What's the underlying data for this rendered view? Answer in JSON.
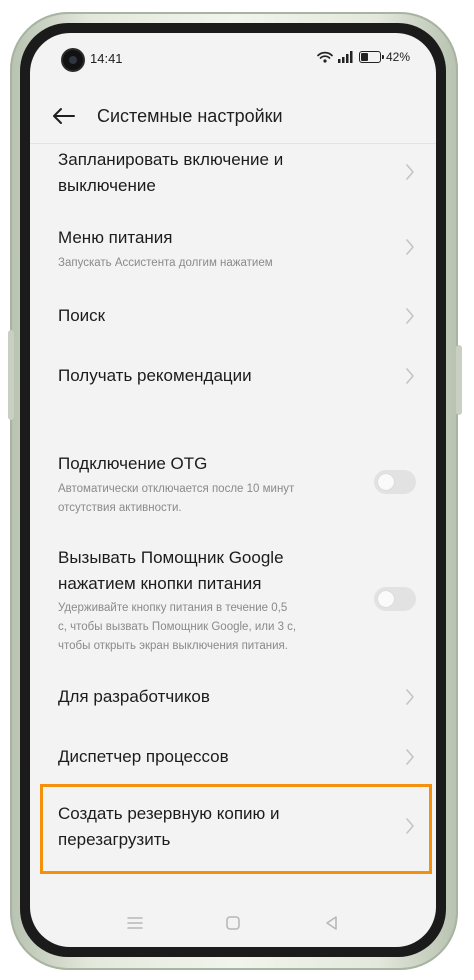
{
  "status_bar": {
    "time": "14:41",
    "battery_percent": "42%",
    "battery_level": 0.42
  },
  "header": {
    "title": "Системные настройки",
    "back_icon": "arrow-left-icon"
  },
  "items": [
    {
      "title_line1": "Запланировать включение и",
      "title_line2": "выключение",
      "control": "chevron"
    },
    {
      "title": "Меню питания",
      "subtitle": "Запускать Ассистента долгим нажатием",
      "control": "chevron"
    },
    {
      "title": "Поиск",
      "control": "chevron"
    },
    {
      "title": "Получать рекомендации",
      "control": "chevron"
    },
    {
      "title": "Подключение OTG",
      "subtitle_line1": "Автоматически отключается после 10 минут",
      "subtitle_line2": "отсутствия активности.",
      "control": "toggle",
      "on": false
    },
    {
      "title_line1": "Вызывать Помощник Google",
      "title_line2": "нажатием кнопки питания",
      "subtitle_line1": "Удерживайте кнопку питания в течение 0,5",
      "subtitle_line2": "с, чтобы вызвать Помощник Google, или 3 с,",
      "subtitle_line3": "чтобы открыть экран выключения питания.",
      "control": "toggle",
      "on": false
    },
    {
      "title": "Для разработчиков",
      "control": "chevron"
    },
    {
      "title": "Диспетчер процессов",
      "control": "chevron"
    },
    {
      "title_line1": "Создать резервную копию и",
      "title_line2": "перезагрузить",
      "control": "chevron",
      "highlighted": true
    }
  ],
  "colors": {
    "highlight": "#f5900c",
    "screen_bg": "#f3f3f3",
    "text_primary": "#1c1c1c",
    "text_secondary": "#8a8a8a"
  }
}
